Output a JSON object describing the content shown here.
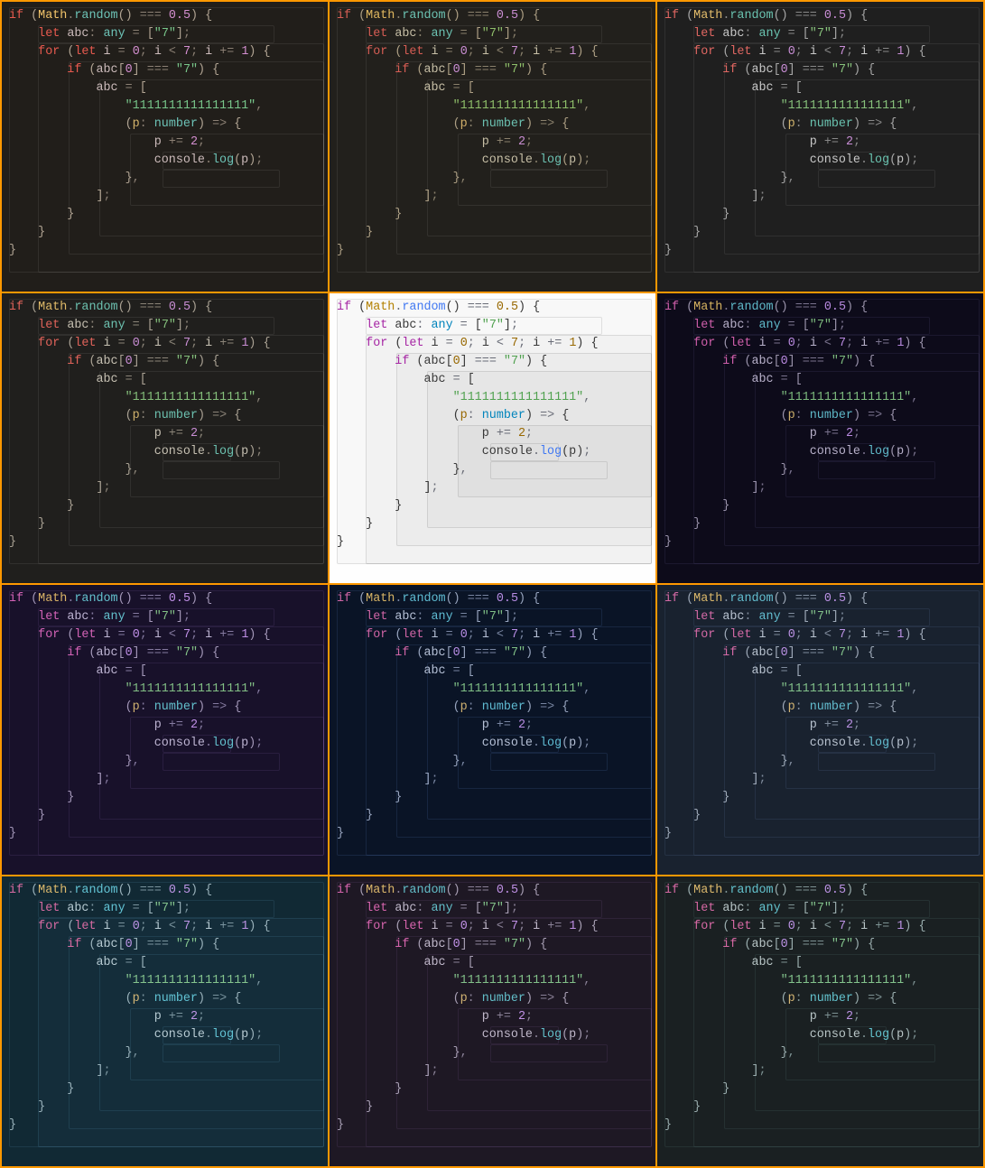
{
  "themes": [
    "t1",
    "t2",
    "t3",
    "t4",
    "t5",
    "t6",
    "t7",
    "t8",
    "t9",
    "t10",
    "t11",
    "t12"
  ],
  "light_index": 4,
  "code_tokens": [
    [
      [
        "kw",
        "if"
      ],
      [
        "pun",
        " "
      ],
      [
        "br",
        "("
      ],
      [
        "cl",
        "Math"
      ],
      [
        "pun",
        "."
      ],
      [
        "fn",
        "random"
      ],
      [
        "br",
        "()"
      ],
      [
        "pun",
        " "
      ],
      [
        "op",
        "==="
      ],
      [
        "pun",
        " "
      ],
      [
        "nu",
        "0.5"
      ],
      [
        "br",
        ")"
      ],
      [
        "pun",
        " "
      ],
      [
        "br",
        "{"
      ]
    ],
    [
      [
        "pun",
        "    "
      ],
      [
        "kw",
        "let"
      ],
      [
        "pun",
        " "
      ],
      [
        "id",
        "abc"
      ],
      [
        "pun",
        ": "
      ],
      [
        "ty",
        "any"
      ],
      [
        "pun",
        " "
      ],
      [
        "op",
        "="
      ],
      [
        "pun",
        " "
      ],
      [
        "br",
        "["
      ],
      [
        "st",
        "\"7\""
      ],
      [
        "br",
        "]"
      ],
      [
        "pun",
        ";"
      ]
    ],
    [
      [
        "pun",
        "    "
      ],
      [
        "kw",
        "for"
      ],
      [
        "pun",
        " "
      ],
      [
        "br",
        "("
      ],
      [
        "kw",
        "let"
      ],
      [
        "pun",
        " "
      ],
      [
        "id",
        "i"
      ],
      [
        "pun",
        " "
      ],
      [
        "op",
        "="
      ],
      [
        "pun",
        " "
      ],
      [
        "nu",
        "0"
      ],
      [
        "pun",
        "; "
      ],
      [
        "id",
        "i"
      ],
      [
        "pun",
        " "
      ],
      [
        "op",
        "<"
      ],
      [
        "pun",
        " "
      ],
      [
        "nu",
        "7"
      ],
      [
        "pun",
        "; "
      ],
      [
        "id",
        "i"
      ],
      [
        "pun",
        " "
      ],
      [
        "op",
        "+="
      ],
      [
        "pun",
        " "
      ],
      [
        "nu",
        "1"
      ],
      [
        "br",
        ")"
      ],
      [
        "pun",
        " "
      ],
      [
        "br",
        "{"
      ]
    ],
    [
      [
        "pun",
        "        "
      ],
      [
        "kw",
        "if"
      ],
      [
        "pun",
        " "
      ],
      [
        "br",
        "("
      ],
      [
        "id",
        "abc"
      ],
      [
        "br",
        "["
      ],
      [
        "nu",
        "0"
      ],
      [
        "br",
        "]"
      ],
      [
        "pun",
        " "
      ],
      [
        "op",
        "==="
      ],
      [
        "pun",
        " "
      ],
      [
        "st",
        "\"7\""
      ],
      [
        "br",
        ")"
      ],
      [
        "pun",
        " "
      ],
      [
        "br",
        "{"
      ]
    ],
    [
      [
        "pun",
        "            "
      ],
      [
        "id",
        "abc"
      ],
      [
        "pun",
        " "
      ],
      [
        "op",
        "="
      ],
      [
        "pun",
        " "
      ],
      [
        "br",
        "["
      ]
    ],
    [
      [
        "pun",
        "                "
      ],
      [
        "st",
        "\"1111111111111111\""
      ],
      [
        "pun",
        ","
      ]
    ],
    [
      [
        "pun",
        "                "
      ],
      [
        "br",
        "("
      ],
      [
        "pa",
        "p"
      ],
      [
        "pun",
        ": "
      ],
      [
        "ty",
        "number"
      ],
      [
        "br",
        ")"
      ],
      [
        "pun",
        " "
      ],
      [
        "op",
        "=>"
      ],
      [
        "pun",
        " "
      ],
      [
        "br",
        "{"
      ]
    ],
    [
      [
        "pun",
        "                    "
      ],
      [
        "id",
        "p"
      ],
      [
        "pun",
        " "
      ],
      [
        "op",
        "+="
      ],
      [
        "pun",
        " "
      ],
      [
        "nu",
        "2"
      ],
      [
        "pun",
        ";"
      ]
    ],
    [
      [
        "pun",
        "                    "
      ],
      [
        "co",
        "console"
      ],
      [
        "pun",
        "."
      ],
      [
        "fn",
        "log"
      ],
      [
        "br",
        "("
      ],
      [
        "id",
        "p"
      ],
      [
        "br",
        ")"
      ],
      [
        "pun",
        ";"
      ]
    ],
    [
      [
        "pun",
        "                "
      ],
      [
        "br",
        "}"
      ],
      [
        "pun",
        ","
      ]
    ],
    [
      [
        "pun",
        "            "
      ],
      [
        "br",
        "]"
      ],
      [
        "pun",
        ";"
      ]
    ],
    [
      [
        "pun",
        "        "
      ],
      [
        "br",
        "}"
      ]
    ],
    [
      [
        "pun",
        "    "
      ],
      [
        "br",
        "}"
      ]
    ],
    [
      [
        "br",
        "}"
      ]
    ]
  ]
}
